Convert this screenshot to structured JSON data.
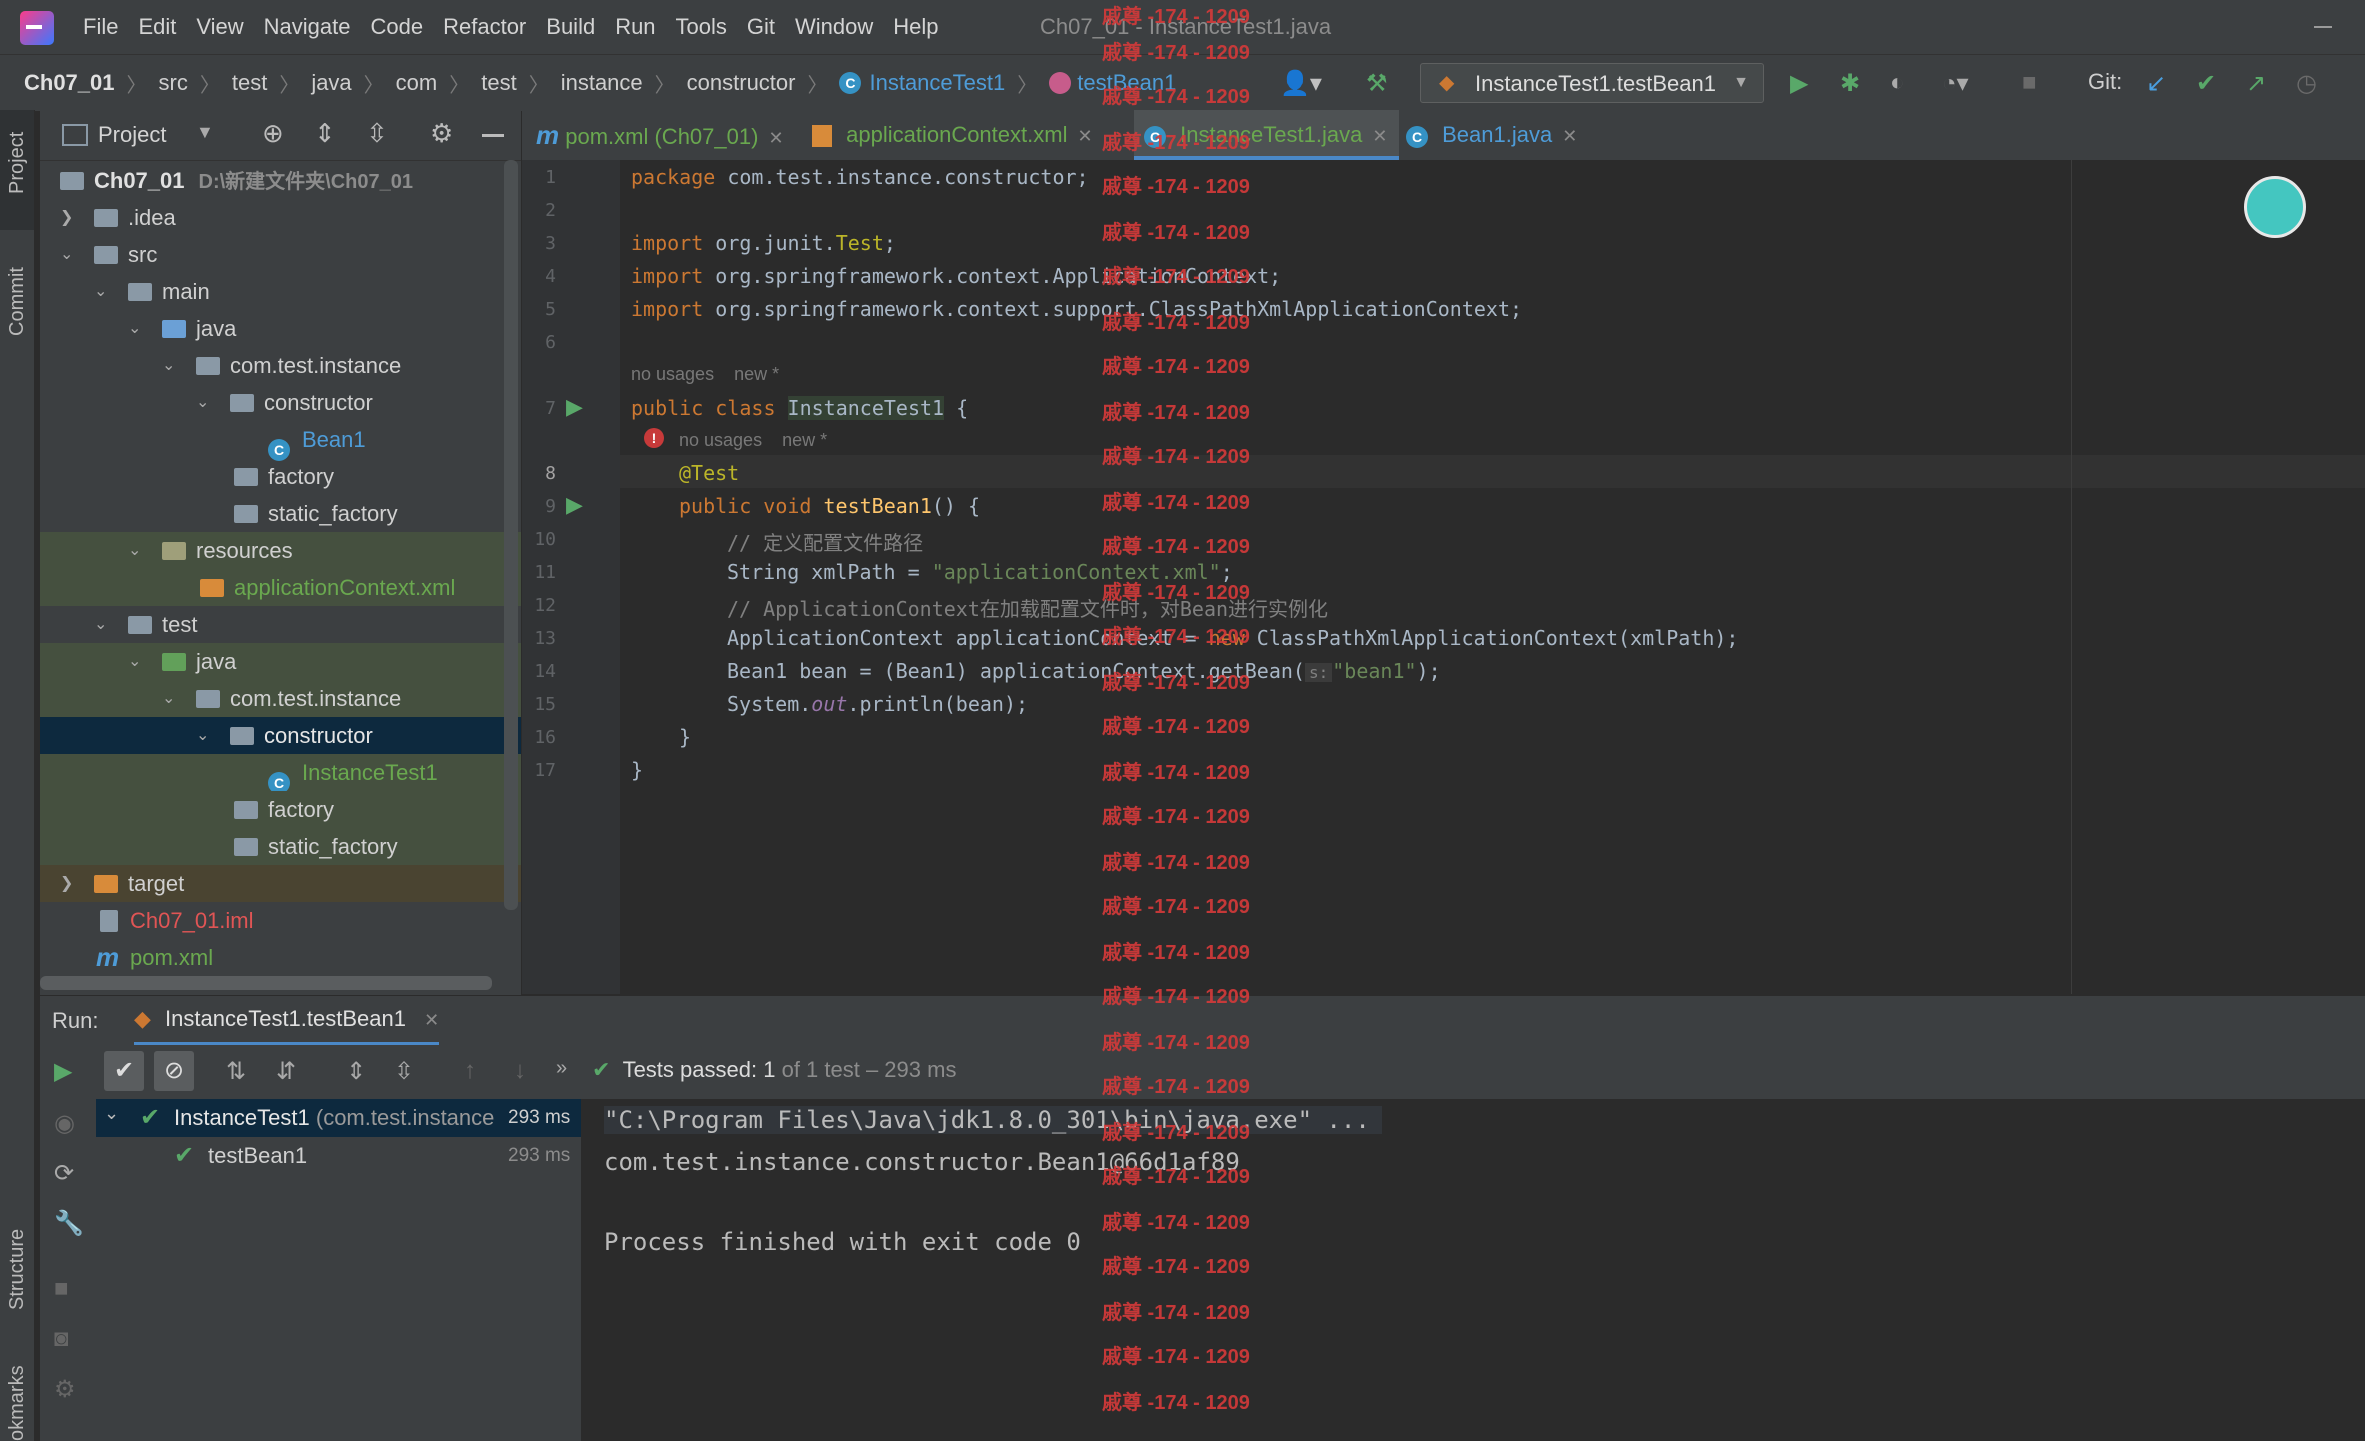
{
  "menubar": {
    "items": [
      "File",
      "Edit",
      "View",
      "Navigate",
      "Code",
      "Refactor",
      "Build",
      "Run",
      "Tools",
      "Git",
      "Window",
      "Help"
    ],
    "window_title": "Ch07_01 - InstanceTest1.java"
  },
  "navbar": {
    "crumbs": [
      "Ch07_01",
      "src",
      "test",
      "java",
      "com",
      "test",
      "instance",
      "constructor",
      "InstanceTest1",
      "testBean1"
    ],
    "run_config": "InstanceTest1.testBean1",
    "git_label": "Git:"
  },
  "left_strip": {
    "project": "Project",
    "commit": "Commit",
    "structure": "Structure",
    "bookmarks": "okmarks"
  },
  "project": {
    "title": "Project",
    "root": "Ch07_01",
    "root_path": "D:\\新建文件夹\\Ch07_01",
    "tree": [
      ".idea",
      "src",
      "main",
      "java",
      "com.test.instance",
      "constructor",
      "Bean1",
      "factory",
      "static_factory",
      "resources",
      "applicationContext.xml",
      "test",
      "java",
      "com.test.instance",
      "constructor",
      "InstanceTest1",
      "factory",
      "static_factory",
      "target",
      "Ch07_01.iml",
      "pom.xml"
    ]
  },
  "tabs": [
    "pom.xml (Ch07_01)",
    "applicationContext.xml",
    "InstanceTest1.java",
    "Bean1.java"
  ],
  "editor": {
    "line_numbers": [
      "1",
      "2",
      "3",
      "4",
      "5",
      "6",
      "7",
      "8",
      "9",
      "10",
      "11",
      "12",
      "13",
      "14",
      "15",
      "16",
      "17"
    ],
    "hint_usages": "no usages",
    "hint_new": "new *",
    "l1_kw": "package",
    "l1_rest": " com.test.instance.constructor;",
    "l3_kw": "import",
    "l3_rest": " org.junit.",
    "l3_cls": "Test",
    "l3_end": ";",
    "l4_kw": "import",
    "l4_rest": " org.springframework.context.ApplicationContext;",
    "l5_kw": "import",
    "l5_rest": " org.springframework.context.support.ClassPathXmlApplicationContext;",
    "l7_kw": "public class",
    "l7_cls": "InstanceTest1",
    "l7_end": " {",
    "l8": "@Test",
    "l9_kw": "public void",
    "l9_fn": "testBean1",
    "l9_end": "() {",
    "l10": "// 定义配置文件路径",
    "l11_a": "String xmlPath = ",
    "l11_str": "\"applicationContext.xml\"",
    "l11_end": ";",
    "l12": "// ApplicationContext在加载配置文件时，对Bean进行实例化",
    "l13_a": "ApplicationContext applicationContext = ",
    "l13_kw": "new",
    "l13_b": " ClassPathXmlApplicationContext(xmlPath);",
    "l14_a": "Bean1 bean = (Bean1) applicationContext.getBean(",
    "l14_hint": "s:",
    "l14_str": "\"bean1\"",
    "l14_end": ");",
    "l15_a": "System.",
    "l15_it": "out",
    "l15_b": ".println(bean);",
    "l16": "}",
    "l17": "}"
  },
  "run": {
    "label": "Run:",
    "tab": "InstanceTest1.testBean1",
    "status_prefix": "Tests passed:",
    "status_count": "1",
    "status_suffix": "of 1 test – 293 ms",
    "tree_root": "InstanceTest1",
    "tree_root_pkg": "(com.test.instance",
    "tree_root_time": "293 ms",
    "tree_child": "testBean1",
    "tree_child_time": "293 ms",
    "console": [
      "\"C:\\Program Files\\Java\\jdk1.8.0_301\\bin\\java.exe\" ...",
      "com.test.instance.constructor.Bean1@66d1af89",
      "",
      "Process finished with exit code 0"
    ]
  },
  "watermark": "戚尊 -174 - 1209",
  "colors": {
    "accent": "#4a88c7",
    "keyword": "#cc7832",
    "string": "#6a8759",
    "pass": "#59a869",
    "watermark": "#d63a3a"
  }
}
